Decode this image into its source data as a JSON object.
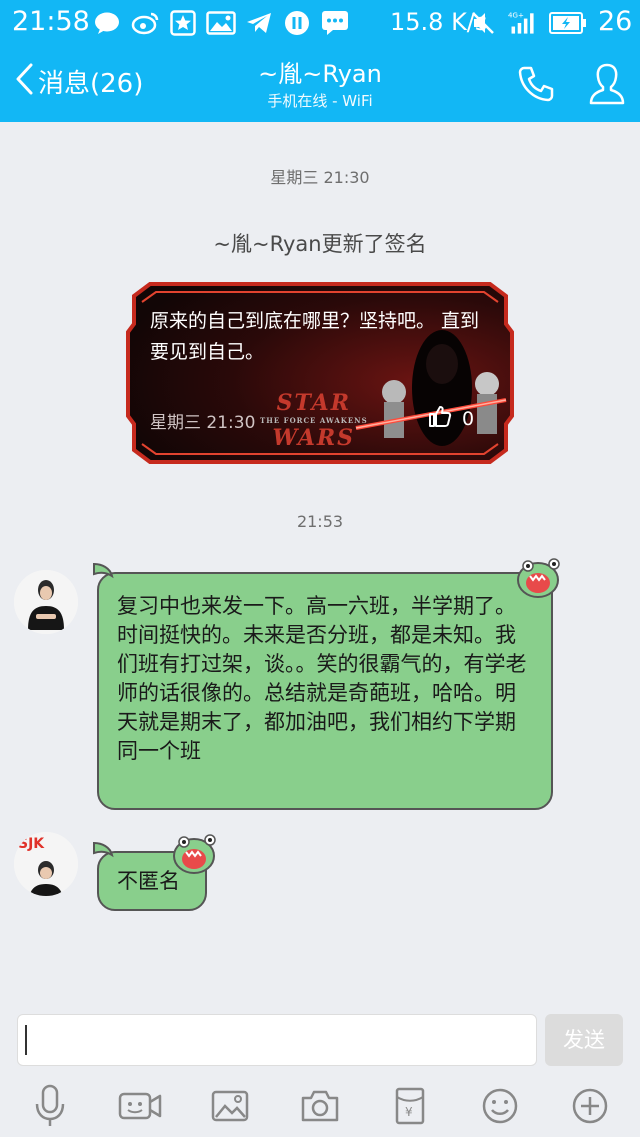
{
  "status_bar": {
    "time": "21:58",
    "net_speed": "15.8 K/s",
    "network": "4G+",
    "battery": "26"
  },
  "header": {
    "back_label": "消息(26)",
    "contact_name": "~胤~Ryan",
    "contact_status": "手机在线 - WiFi"
  },
  "chat": {
    "timestamp_1": "星期三 21:30",
    "system_message": "~胤~Ryan更新了签名",
    "signature_card": {
      "text": "原来的自己到底在哪里？坚持吧。 直到要见到自己。",
      "time": "星期三 21:30",
      "likes": "0",
      "logo_line1": "STAR",
      "logo_line2": "THE FORCE AWAKENS",
      "logo_line3": "WARS"
    },
    "timestamp_2": "21:53",
    "messages": [
      {
        "text": "复习中也来发一下。高一六班，半学期了。时间挺快的。未来是否分班，都是未知。我们班有打过架，谈。。笑的很霸气的，有学老师的话很像的。总结就是奇葩班，哈哈。明天就是期末了，都加油吧，我们相约下学期同一个班"
      },
      {
        "text": "不匿名"
      }
    ]
  },
  "composer": {
    "input_value": "",
    "send_label": "发送"
  },
  "colors": {
    "accent": "#12b7f5",
    "bubble": "#89cf8c",
    "background": "#eceef2"
  },
  "toolbar": [
    "mic-icon",
    "video-icon",
    "image-icon",
    "camera-icon",
    "red-packet-icon",
    "emoji-icon",
    "plus-icon"
  ]
}
